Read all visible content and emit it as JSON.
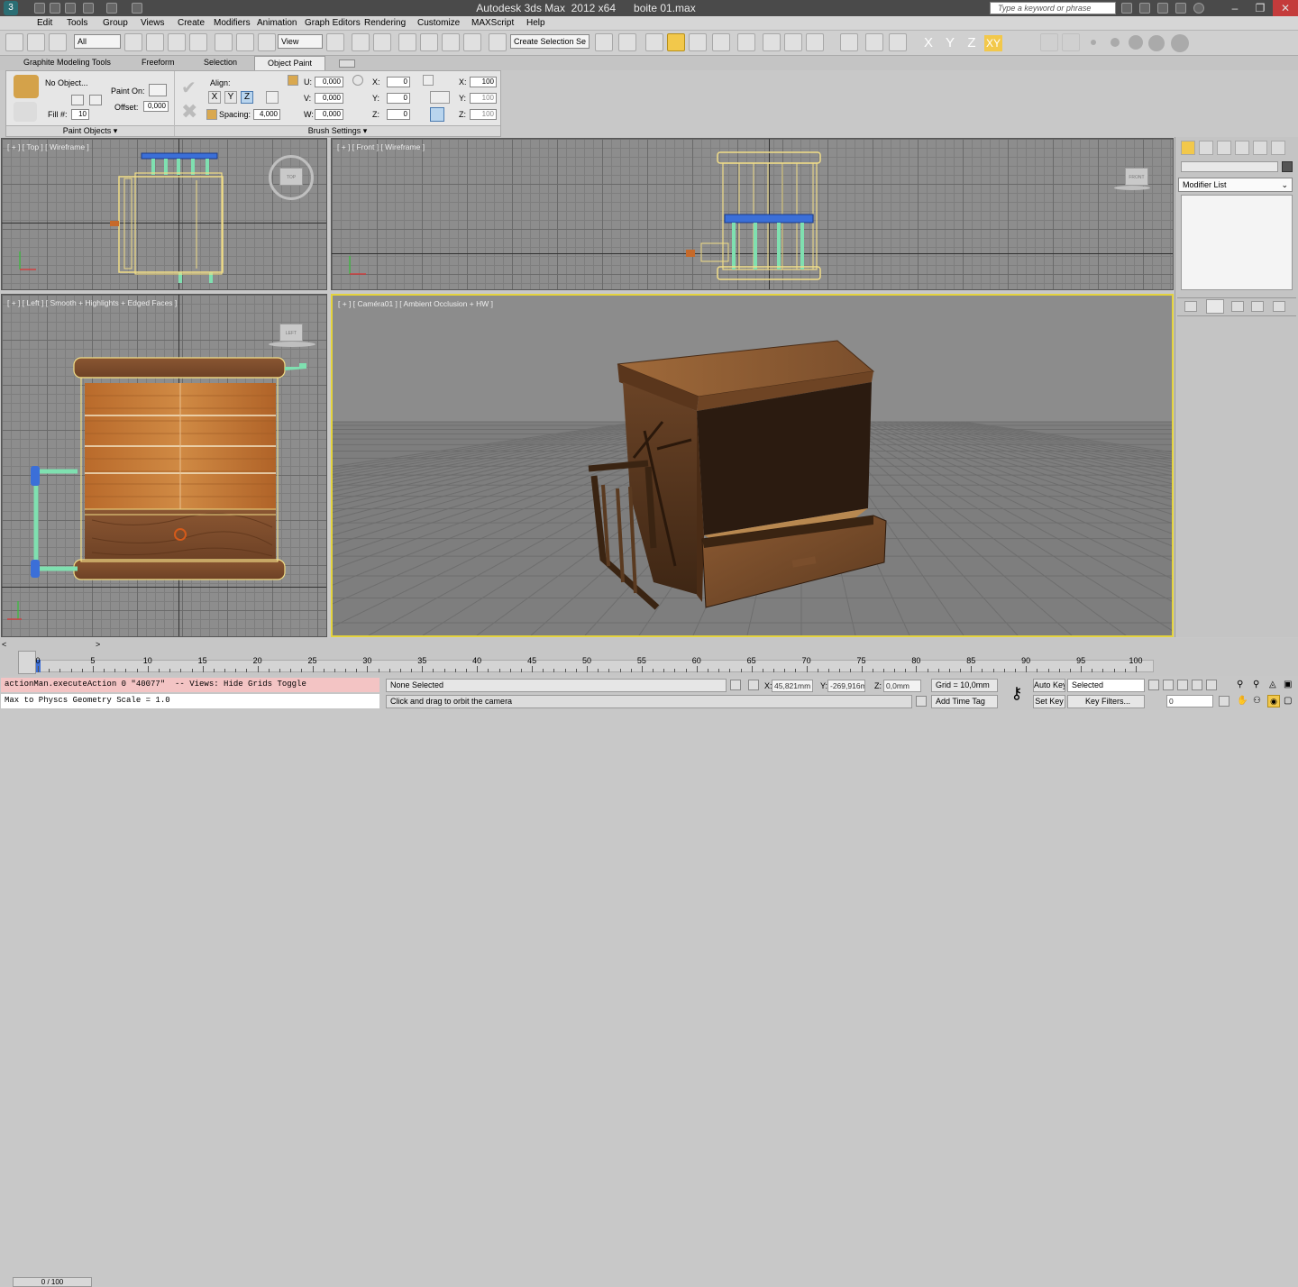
{
  "app": {
    "title": "Autodesk 3ds Max  2012 x64      boite 01.max",
    "search_placeholder": "Type a keyword or phrase"
  },
  "menu": [
    "Edit",
    "Tools",
    "Group",
    "Views",
    "Create",
    "Modifiers",
    "Animation",
    "Graph Editors",
    "Rendering",
    "Customize",
    "MAXScript",
    "Help"
  ],
  "toolbar": {
    "filter_value": "All",
    "coord_value": "View",
    "selection_set_placeholder": "Create Selection Se",
    "axes": [
      "X",
      "Y",
      "Z",
      "XY"
    ],
    "active_axis": "XY"
  },
  "ribbon": {
    "tabs": [
      "Graphite Modeling Tools",
      "Freeform",
      "Selection",
      "Object Paint"
    ],
    "active_tab": "Object Paint",
    "no_object": "No Object...",
    "paint_on_label": "Paint On:",
    "fill_label": "Fill #:",
    "fill_value": "10",
    "offset_label": "Offset:",
    "offset_value": "0,000",
    "align_label": "Align:",
    "align_axes": [
      "X",
      "Y",
      "Z"
    ],
    "spacing_label": "Spacing:",
    "spacing_value": "4,000",
    "u_label": "U:",
    "u_value": "0,000",
    "v_label": "V:",
    "v_value": "0,000",
    "w_label": "W:",
    "w_value": "0,000",
    "rx_label": "X:",
    "rx_value": "0",
    "ry_label": "Y:",
    "ry_value": "0",
    "rz_label": "Z:",
    "rz_value": "0",
    "sx_label": "X:",
    "sx_value": "100",
    "sy_label": "Y:",
    "sy_value": "100",
    "sz_label": "Z:",
    "sz_value": "100",
    "section_paint_objects": "Paint Objects",
    "section_brush_settings": "Brush Settings"
  },
  "viewports": {
    "top": {
      "label": "[ + ] [ Top ] [ Wireframe ]",
      "cube": "TOP"
    },
    "front": {
      "label": "[ + ] [ Front ] [ Wireframe ]",
      "cube": "FRONT"
    },
    "left": {
      "label": "[ + ] [ Left ] [ Smooth + Highlights + Edged Faces ]",
      "cube": "LEFT"
    },
    "camera": {
      "label": "[ + ] [ Caméra01 ] [ Ambient Occlusion + HW ]"
    }
  },
  "command_panel": {
    "modifier_list": "Modifier List"
  },
  "timeline": {
    "frame_display": "0 / 100",
    "ticks": [
      "0",
      "5",
      "10",
      "15",
      "20",
      "25",
      "30",
      "35",
      "40",
      "45",
      "50",
      "55",
      "60",
      "65",
      "70",
      "75",
      "80",
      "85",
      "90",
      "95",
      "100"
    ]
  },
  "status": {
    "listener_line1": "actionMan.executeAction 0 \"40077\"  -- Views: Hide Grids Toggle",
    "listener_line2": "Max to Physcs Geometry Scale = 1.0",
    "selection_status": "None Selected",
    "prompt": "Click and drag to orbit the camera",
    "x_label": "X:",
    "x_value": "45,821mm",
    "y_label": "Y:",
    "y_value": "-269,916m",
    "z_label": "Z:",
    "z_value": "0,0mm",
    "grid": "Grid = 10,0mm",
    "add_time_tag": "Add Time Tag",
    "auto_key": "Auto Key",
    "set_key": "Set Key",
    "key_mode_value": "Selected",
    "key_filters": "Key Filters...",
    "current_frame": "0"
  },
  "colors": {
    "active_yellow": "#f2c84b",
    "viewport_border_active": "#e4d33d",
    "listener_pink": "#f3c4c4",
    "listener_white": "#ffffff"
  }
}
